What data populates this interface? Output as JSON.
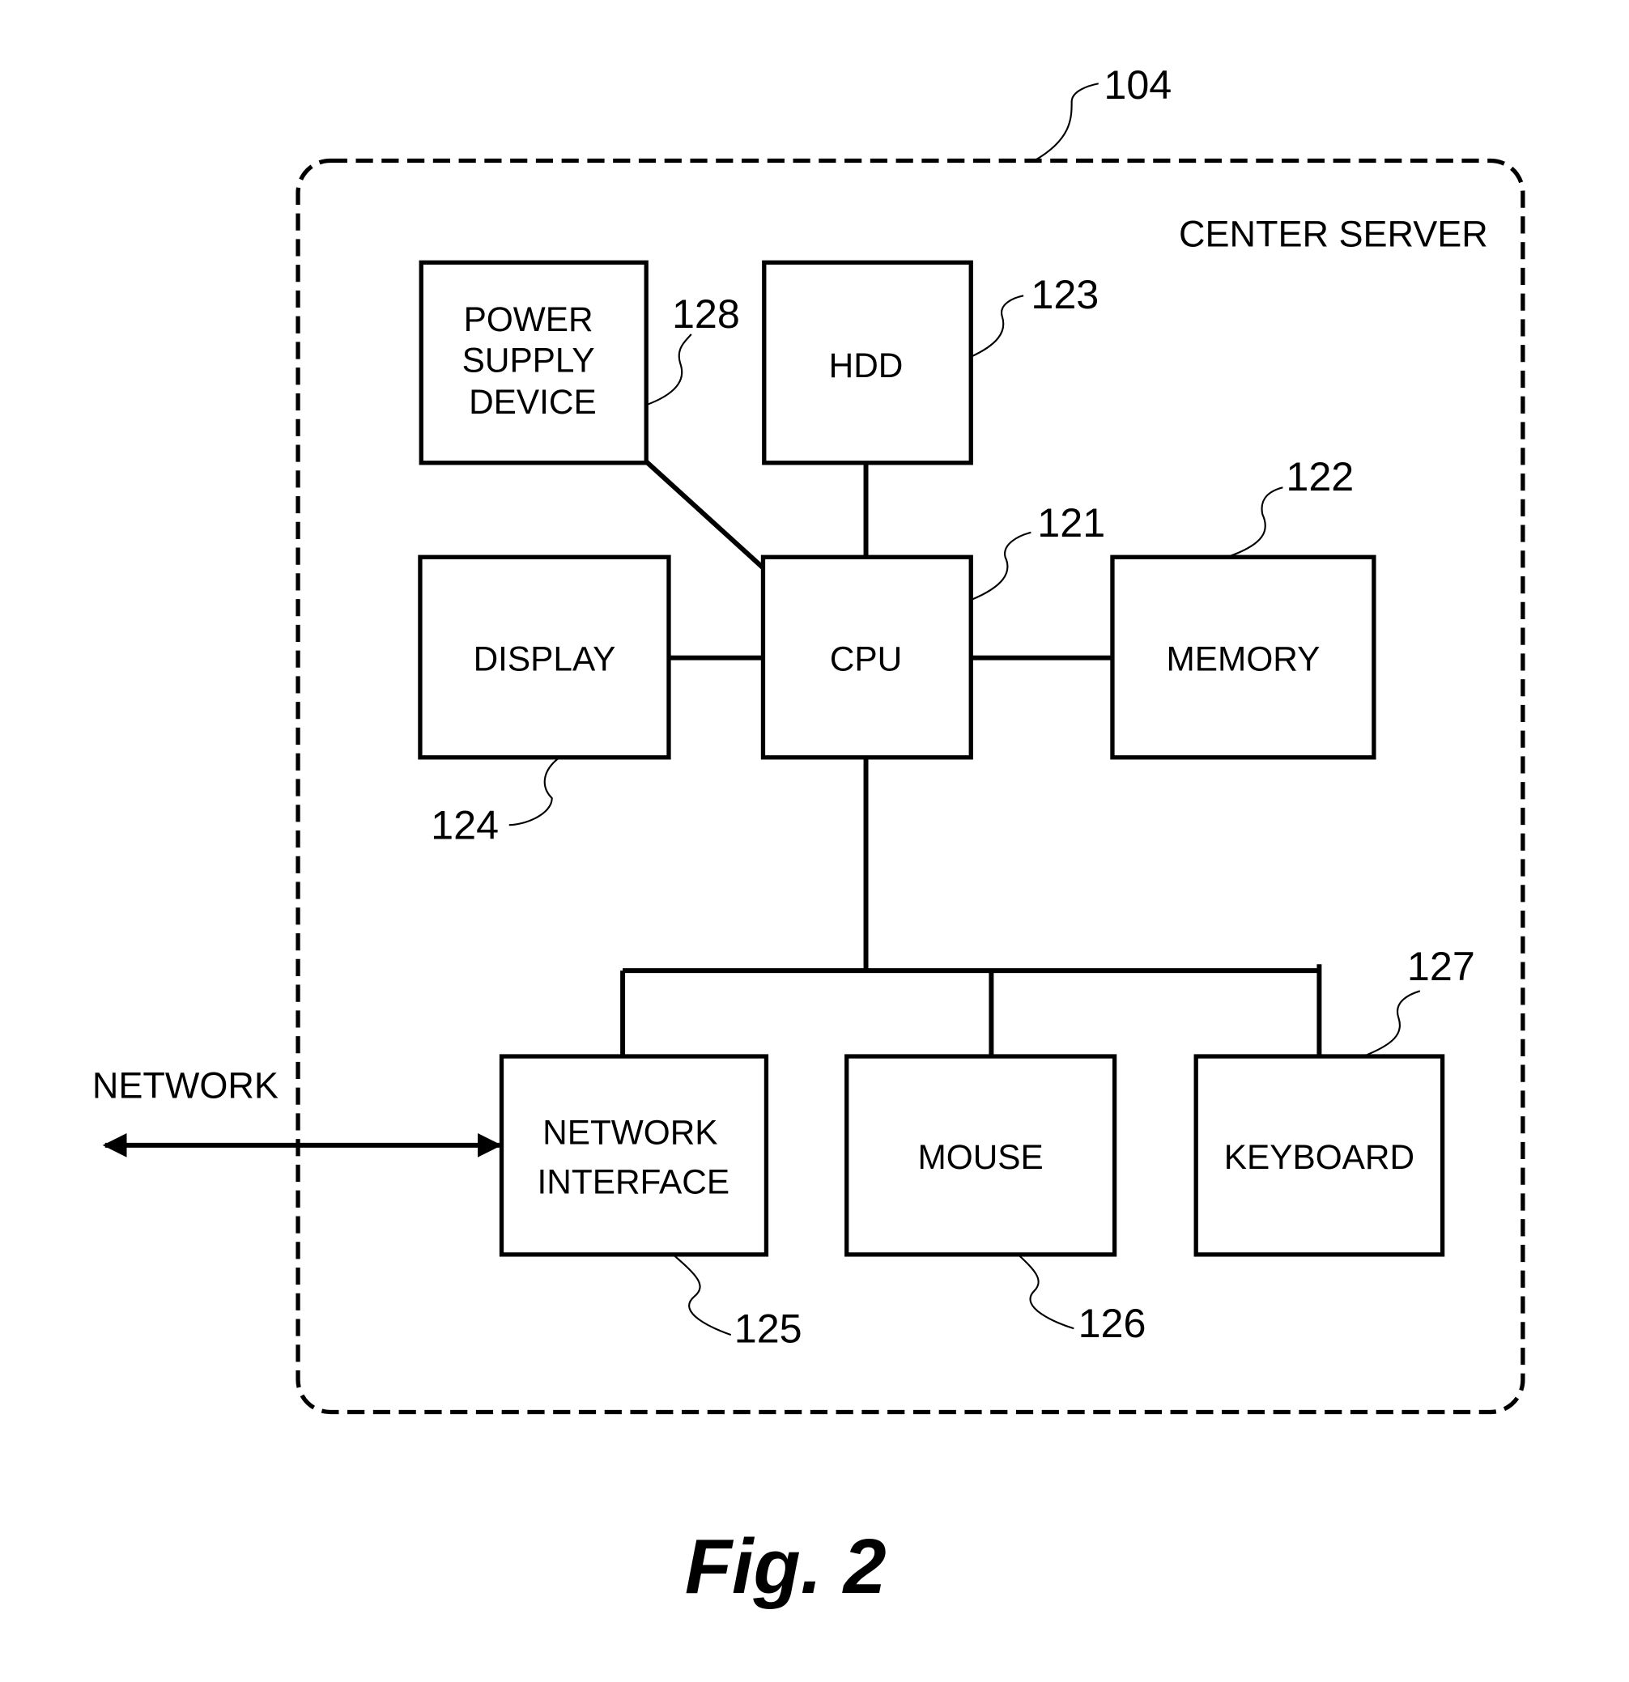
{
  "figure": {
    "caption": "Fig. 2",
    "container": {
      "label": "CENTER SERVER",
      "ref": "104"
    },
    "external": {
      "label": "NETWORK"
    },
    "blocks": {
      "power": {
        "lines": [
          "POWER",
          "SUPPLY",
          "DEVICE"
        ],
        "ref": "128"
      },
      "hdd": {
        "lines": [
          "HDD"
        ],
        "ref": "123"
      },
      "display": {
        "lines": [
          "DISPLAY"
        ],
        "ref": "124"
      },
      "cpu": {
        "lines": [
          "CPU"
        ],
        "ref": "121"
      },
      "memory": {
        "lines": [
          "MEMORY"
        ],
        "ref": "122"
      },
      "netif": {
        "lines": [
          "NETWORK",
          "INTERFACE"
        ],
        "ref": "125"
      },
      "mouse": {
        "lines": [
          "MOUSE"
        ],
        "ref": "126"
      },
      "keyboard": {
        "lines": [
          "KEYBOARD"
        ],
        "ref": "127"
      }
    }
  }
}
